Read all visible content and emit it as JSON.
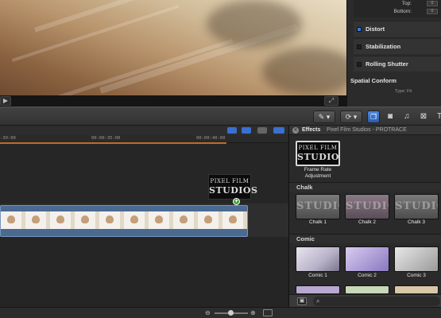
{
  "timeline": {
    "ruler_ticks": [
      "-30:00",
      "00:00:35:00",
      "00:00:40:00"
    ]
  },
  "inspector": {
    "top_label": "Top:",
    "bottom_label": "Bottom:",
    "distort": "Distort",
    "stabilization": "Stabilization",
    "rolling_shutter": "Rolling Shutter",
    "spatial_conform": "Spatial Conform",
    "type_label": "Type:  Fit"
  },
  "floating_title": {
    "line1": "PIXEL FILM",
    "line2": "STUDIOS"
  },
  "effects": {
    "title": "Effects",
    "subtitle": "Pixel Film Studios - PROTRACE",
    "featured": {
      "logo1": "PIXEL FILM",
      "logo2": "STUDIOS",
      "label_line1": "Frame Rate",
      "label_line2": "Adjustment"
    },
    "categories": [
      {
        "name": "Chalk",
        "items": [
          "Chalk 1",
          "Chalk 2",
          "Chalk 3"
        ]
      },
      {
        "name": "Comic",
        "items": [
          "Comic 1",
          "Comic 2",
          "Comic 3"
        ]
      }
    ],
    "chalk_word": "STUDIOS"
  },
  "colors": {
    "accent_blue": "#3a7ad8",
    "playhead_orange": "#c06a2a",
    "clip_blue": "#4a6a92"
  },
  "icons": {
    "viewer_play": "play-icon",
    "viewer_fullscreen": "fullscreen-icon",
    "toolbar": [
      "select-tool-icon",
      "retime-icon",
      "effects-browser-icon",
      "photos-icon",
      "music-icon",
      "transitions-icon",
      "titles-icon"
    ],
    "footer": [
      "library-icon",
      "search-icon"
    ]
  }
}
